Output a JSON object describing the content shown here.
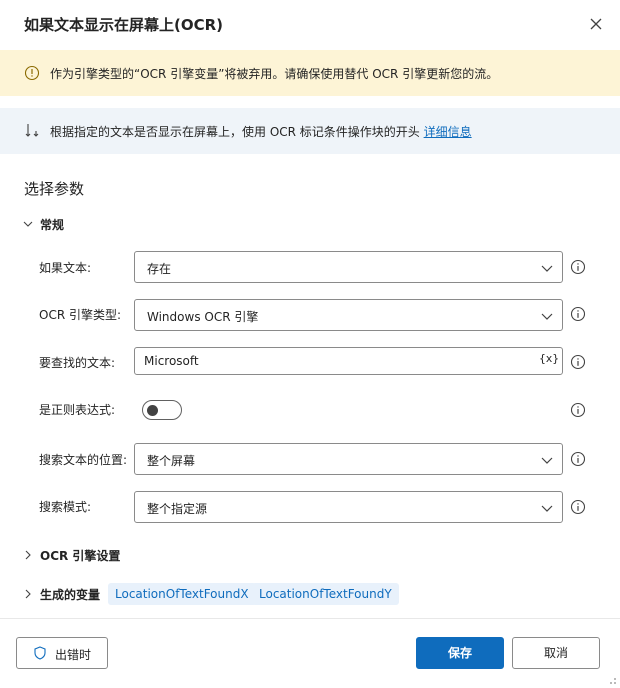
{
  "dialog": {
    "title": "如果文本显示在屏幕上(OCR)"
  },
  "warning": {
    "text": "作为引擎类型的“OCR 引擎变量”将被弃用。请确保使用替代 OCR 引擎更新您的流。"
  },
  "info": {
    "text": "根据指定的文本是否显示在屏幕上，使用 OCR 标记条件操作块的开头 ",
    "link": "详细信息"
  },
  "params": {
    "section_title": "选择参数",
    "general_label": "常规",
    "fields": {
      "if_text": {
        "label": "如果文本:",
        "value": "存在"
      },
      "ocr_engine": {
        "label": "OCR 引擎类型:",
        "value": "Windows OCR 引擎"
      },
      "text_to_find": {
        "label": "要查找的文本:",
        "value": "Microsoft",
        "var_button": "{x}"
      },
      "is_regex": {
        "label": "是正则表达式:",
        "checked": false
      },
      "search_location": {
        "label": "搜索文本的位置:",
        "value": "整个屏幕"
      },
      "search_mode": {
        "label": "搜索模式:",
        "value": "整个指定源"
      }
    },
    "ocr_settings_label": "OCR 引擎设置",
    "generated_vars_label": "生成的变量",
    "generated_vars": [
      "LocationOfTextFoundX",
      "LocationOfTextFoundY"
    ]
  },
  "footer": {
    "on_error_label": "出错时",
    "save_label": "保存",
    "cancel_label": "取消"
  },
  "colors": {
    "accent": "#0f6cbd",
    "warning_bg": "#fdf4d6",
    "info_bg": "#eff4f9",
    "chip_bg": "#e8f1fb"
  },
  "icons": [
    "close-icon",
    "warning-info-icon",
    "branch-icon",
    "chevron-down-icon",
    "chevron-right-icon",
    "help-icon",
    "shield-icon",
    "resize-grip-icon"
  ]
}
